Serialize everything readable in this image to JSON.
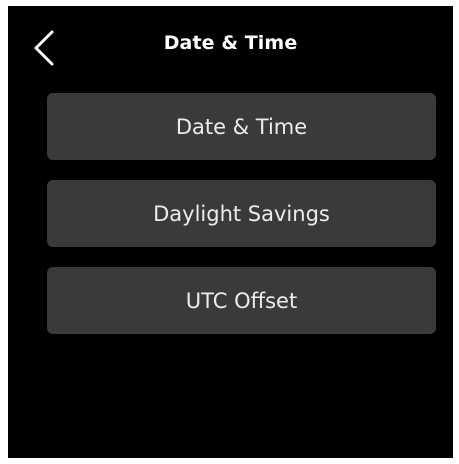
{
  "header": {
    "title": "Date & Time",
    "back_icon": "chevron-left-icon"
  },
  "menu": {
    "items": [
      {
        "label": "Date & Time"
      },
      {
        "label": "Daylight Savings"
      },
      {
        "label": "UTC Offset"
      }
    ]
  },
  "colors": {
    "screen_background": "#000000",
    "button_background": "#3a3a3a",
    "text": "#ffffff"
  }
}
